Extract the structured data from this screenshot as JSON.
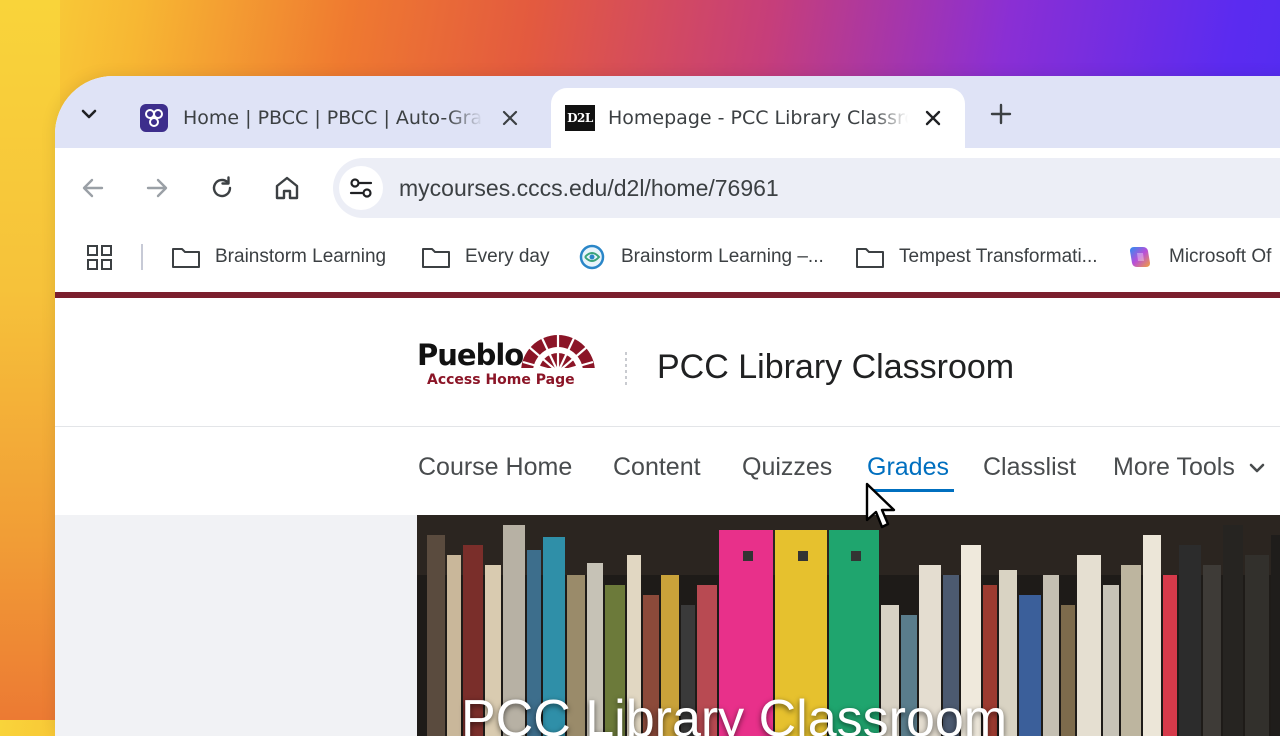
{
  "browser": {
    "tabs": [
      {
        "title": "Home | PBCC | PBCC | Auto-Graphic",
        "active": false,
        "favicon": "pbcc-favicon"
      },
      {
        "title": "Homepage - PCC Library Classroom",
        "active": true,
        "favicon": "d2l-favicon",
        "favicon_text": "D2L"
      }
    ],
    "url": "mycourses.cccs.edu/d2l/home/76961",
    "bookmarks": [
      {
        "label": "Brainstorm Learning",
        "icon": "folder-icon"
      },
      {
        "label": "Every day",
        "icon": "folder-icon"
      },
      {
        "label": "Brainstorm Learning –...",
        "icon": "brainstorm-logo-icon"
      },
      {
        "label": "Tempest Transformati...",
        "icon": "folder-icon"
      },
      {
        "label": "Microsoft Of",
        "icon": "copilot-icon"
      }
    ]
  },
  "site": {
    "logo": {
      "word": "Pueblo",
      "subtitle": "Access Home Page"
    },
    "course_title": "PCC Library Classroom",
    "nav": [
      {
        "label": "Course Home",
        "active": false
      },
      {
        "label": "Content",
        "active": false
      },
      {
        "label": "Quizzes",
        "active": false
      },
      {
        "label": "Grades",
        "active": true
      },
      {
        "label": "Classlist",
        "active": false
      },
      {
        "label": "More Tools",
        "active": false
      }
    ],
    "banner_title": "PCC Library Classroom"
  },
  "colors": {
    "brand": "#7b1f2e",
    "link_active": "#006fbf"
  }
}
